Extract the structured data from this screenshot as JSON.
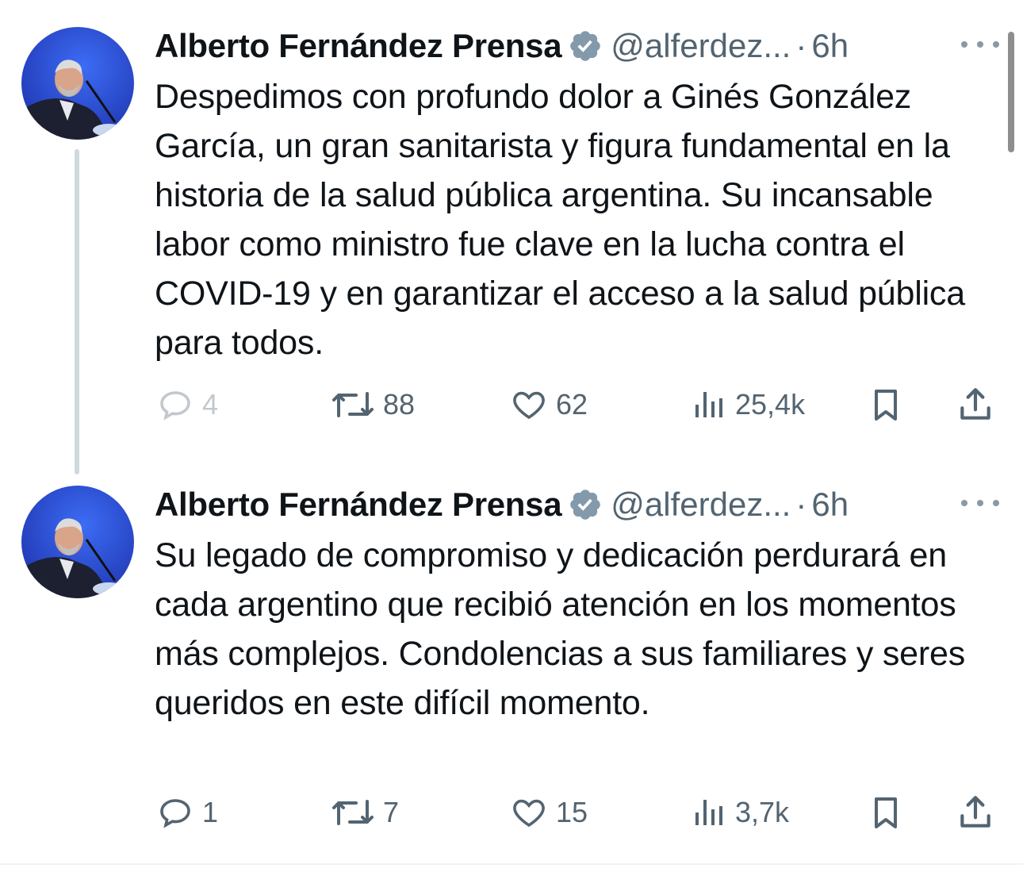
{
  "tweets": [
    {
      "author_name": "Alberto Fernández Prensa",
      "verified_icon": "verified-badge-icon",
      "handle": "@alferdez...",
      "separator": "·",
      "time": "6h",
      "text": "Despedimos con profundo dolor a Ginés González García, un gran sanitarista y figura fundamental en la historia de la salud pública argentina. Su incansable labor como ministro fue clave en la lucha contra el COVID-19 y en garantizar el acceso a la salud pública para todos.",
      "replies": "4",
      "retweets": "88",
      "likes": "62",
      "views": "25,4k"
    },
    {
      "author_name": "Alberto Fernández Prensa",
      "verified_icon": "verified-badge-icon",
      "handle": "@alferdez...",
      "separator": "·",
      "time": "6h",
      "text": "Su legado de compromiso y dedicación perdurará en cada argentino que recibió atención en los momentos más complejos. Condolencias a sus familiares y seres queridos en este difícil momento.",
      "replies": "1",
      "retweets": "7",
      "likes": "15",
      "views": "3,7k"
    }
  ],
  "colors": {
    "text": "#0f1419",
    "secondary": "#536471",
    "verified": "#829aab",
    "thread_line": "#cfd9de",
    "avatar_background": "#2a4fd6"
  }
}
